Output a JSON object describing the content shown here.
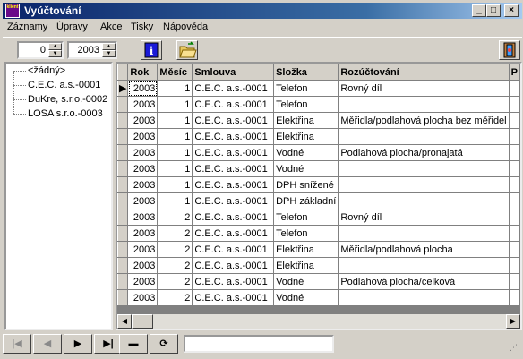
{
  "window": {
    "title": "Vyúčtování",
    "icon_text": "klient"
  },
  "menu": [
    "Záznamy",
    "Úpravy",
    "Akce",
    "Tisky",
    "Nápověda"
  ],
  "toolbar": {
    "month_value": "0",
    "year_value": "2003"
  },
  "tree": {
    "items": [
      "<žádný>",
      "C.E.C. a.s.-0001",
      "DuKre, s.r.o.-0002",
      "LOSA s.r.o.-0003"
    ]
  },
  "grid": {
    "columns": [
      "Rok",
      "Měsíc",
      "Smlouva",
      "Složka",
      "Rozúčtování",
      "P"
    ],
    "rows": [
      [
        "2003",
        "1",
        "C.E.C. a.s.-0001",
        "Telefon",
        "Rovný díl"
      ],
      [
        "2003",
        "1",
        "C.E.C. a.s.-0001",
        "Telefon",
        ""
      ],
      [
        "2003",
        "1",
        "C.E.C. a.s.-0001",
        "Elektřina",
        "Měřidla/podlahová plocha bez měřidel"
      ],
      [
        "2003",
        "1",
        "C.E.C. a.s.-0001",
        "Elektřina",
        ""
      ],
      [
        "2003",
        "1",
        "C.E.C. a.s.-0001",
        "Vodné",
        "Podlahová plocha/pronajatá"
      ],
      [
        "2003",
        "1",
        "C.E.C. a.s.-0001",
        "Vodné",
        ""
      ],
      [
        "2003",
        "1",
        "C.E.C. a.s.-0001",
        "DPH snížené",
        ""
      ],
      [
        "2003",
        "1",
        "C.E.C. a.s.-0001",
        "DPH základní",
        ""
      ],
      [
        "2003",
        "2",
        "C.E.C. a.s.-0001",
        "Telefon",
        "Rovný díl"
      ],
      [
        "2003",
        "2",
        "C.E.C. a.s.-0001",
        "Telefon",
        ""
      ],
      [
        "2003",
        "2",
        "C.E.C. a.s.-0001",
        "Elektřina",
        "Měřidla/podlahová plocha"
      ],
      [
        "2003",
        "2",
        "C.E.C. a.s.-0001",
        "Elektřina",
        ""
      ],
      [
        "2003",
        "2",
        "C.E.C. a.s.-0001",
        "Vodné",
        "Podlahová plocha/celková"
      ],
      [
        "2003",
        "2",
        "C.E.C. a.s.-0001",
        "Vodné",
        ""
      ]
    ]
  },
  "navigator": {
    "status_value": ""
  },
  "colors": {
    "title_start": "#0a246a",
    "title_end": "#a6caf0",
    "face": "#d4d0c8"
  }
}
